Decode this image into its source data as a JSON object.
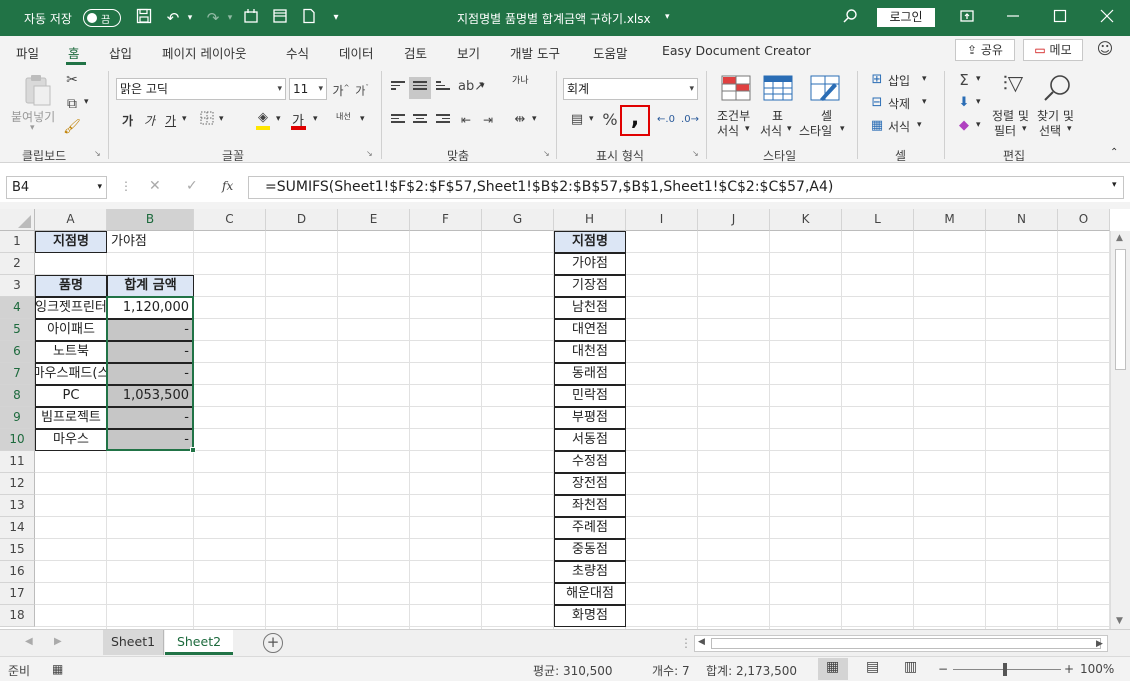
{
  "titlebar": {
    "autosave_label": "자동 저장",
    "autosave_state": "끔",
    "file_title": "지점명별 품명별 합계금액 구하기.xlsx",
    "login_label": "로그인"
  },
  "menu": {
    "tabs": [
      "파일",
      "홈",
      "삽입",
      "페이지 레이아웃",
      "수식",
      "데이터",
      "검토",
      "보기",
      "개발 도구",
      "도움말",
      "Easy Document Creator"
    ],
    "active_tab": "홈",
    "share_label": "공유",
    "memo_label": "메모"
  },
  "ribbon": {
    "clipboard": {
      "label": "클립보드",
      "paste_label": "붙여넣기"
    },
    "font": {
      "label": "글꼴",
      "font_name": "맑은 고딕",
      "font_size": "11",
      "bold": "가",
      "italic": "가",
      "underline": "가",
      "font_color_glyph": "가",
      "phonetic": "내선"
    },
    "alignment": {
      "label": "맞춤",
      "wrap": "가나"
    },
    "number": {
      "label": "표시 형식",
      "format": "회계"
    },
    "styles": {
      "label": "스타일",
      "conditional_line1": "조건부",
      "conditional_line2": "서식",
      "table_line1": "표",
      "table_line2": "서식",
      "cell_line1": "셀",
      "cell_line2": "스타일"
    },
    "cells": {
      "label": "셀",
      "insert": "삽입",
      "delete": "삭제",
      "format": "서식"
    },
    "editing": {
      "label": "편집",
      "sort_line1": "정렬 및",
      "sort_line2": "필터",
      "find_line1": "찾기 및",
      "find_line2": "선택"
    }
  },
  "formula_bar": {
    "name_box": "B4",
    "fx_label": "fx",
    "formula": "=SUMIFS(Sheet1!$F$2:$F$57,Sheet1!$B$2:$B$57,$B$1,Sheet1!$C$2:$C$57,A4)"
  },
  "grid": {
    "columns": [
      "A",
      "B",
      "C",
      "D",
      "E",
      "F",
      "G",
      "H",
      "I",
      "J",
      "K",
      "L",
      "M",
      "N",
      "O"
    ],
    "rows": [
      "1",
      "2",
      "3",
      "4",
      "5",
      "6",
      "7",
      "8",
      "9",
      "10",
      "11",
      "12",
      "13",
      "14",
      "15",
      "16",
      "17",
      "18"
    ],
    "selected_col": "B",
    "selected_rows": [
      "4",
      "5",
      "6",
      "7",
      "8",
      "9",
      "10"
    ],
    "A1": "지점명",
    "B1": "가야점",
    "A3": "품명",
    "B3": "합계 금액",
    "items": [
      "잉크젯프린터",
      "아이패드",
      "노트북",
      "마우스패드(스",
      "PC",
      "빔프로젝트",
      "마우스"
    ],
    "amounts": [
      "1,120,000",
      "-",
      "-",
      "-",
      "1,053,500",
      "-",
      "-"
    ],
    "branch_header": "지점명",
    "branches": [
      "가야점",
      "기장점",
      "남천점",
      "대연점",
      "대천점",
      "동래점",
      "민락점",
      "부평점",
      "서동점",
      "수정점",
      "장전점",
      "좌천점",
      "주례점",
      "중동점",
      "초량점",
      "해운대점",
      "화명점"
    ]
  },
  "sheets": {
    "tabs": [
      "Sheet1",
      "Sheet2"
    ],
    "active": "Sheet2"
  },
  "status": {
    "ready": "준비",
    "average_label": "평균: 310,500",
    "count_label": "개수: 7",
    "sum_label": "합계: 2,173,500",
    "zoom": "100%"
  },
  "colors": {
    "excel_green": "#217346",
    "header_fill": "#dce6f5",
    "highlight_red": "#e00000",
    "selection_fill": "#c6c6c6"
  }
}
